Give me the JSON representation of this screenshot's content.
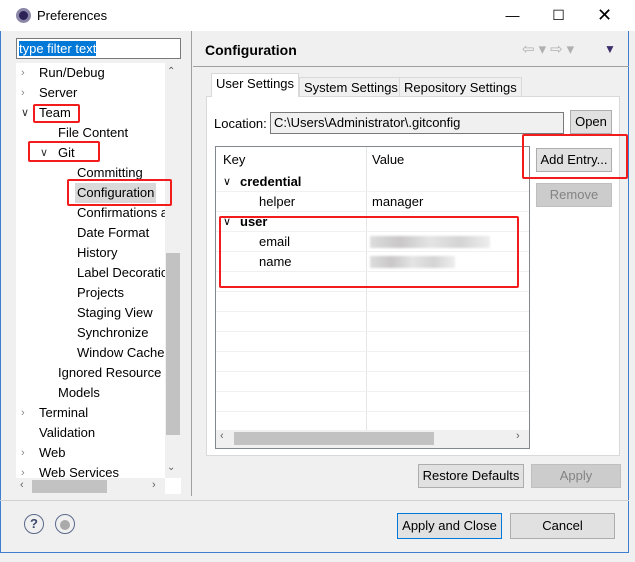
{
  "window": {
    "title": "Preferences",
    "controls": [
      "minimize",
      "maximize",
      "close"
    ]
  },
  "filter": {
    "value": "type filter text"
  },
  "tree": [
    {
      "label": "Run/Debug",
      "level": 0,
      "expander": "collapsed"
    },
    {
      "label": "Server",
      "level": 0,
      "expander": "collapsed"
    },
    {
      "label": "Team",
      "level": 0,
      "expander": "expanded"
    },
    {
      "label": "File Content",
      "level": 1,
      "expander": "none"
    },
    {
      "label": "Git",
      "level": 1,
      "expander": "expanded"
    },
    {
      "label": "Committing",
      "level": 2,
      "expander": "none"
    },
    {
      "label": "Configuration",
      "level": 2,
      "expander": "none",
      "selected": true
    },
    {
      "label": "Confirmations a",
      "level": 2,
      "expander": "none"
    },
    {
      "label": "Date Format",
      "level": 2,
      "expander": "none"
    },
    {
      "label": "History",
      "level": 2,
      "expander": "none"
    },
    {
      "label": "Label Decoratio",
      "level": 2,
      "expander": "none"
    },
    {
      "label": "Projects",
      "level": 2,
      "expander": "none"
    },
    {
      "label": "Staging View",
      "level": 2,
      "expander": "none"
    },
    {
      "label": "Synchronize",
      "level": 2,
      "expander": "none"
    },
    {
      "label": "Window Cache",
      "level": 2,
      "expander": "none"
    },
    {
      "label": "Ignored Resource",
      "level": 1,
      "expander": "none"
    },
    {
      "label": "Models",
      "level": 1,
      "expander": "none"
    },
    {
      "label": "Terminal",
      "level": 0,
      "expander": "collapsed"
    },
    {
      "label": "Validation",
      "level": 0,
      "expander": "none"
    },
    {
      "label": "Web",
      "level": 0,
      "expander": "collapsed"
    },
    {
      "label": "Web Services",
      "level": 0,
      "expander": "collapsed"
    }
  ],
  "page": {
    "title": "Configuration"
  },
  "tabs": [
    {
      "label": "User Settings",
      "active": true
    },
    {
      "label": "System Settings"
    },
    {
      "label": "Repository Settings"
    }
  ],
  "location": {
    "label": "Location:",
    "value": "C:\\Users\\Administrator\\.gitconfig",
    "open_label": "Open"
  },
  "table": {
    "columns": [
      "Key",
      "Value"
    ],
    "rows": [
      {
        "key": "credential",
        "value": "",
        "section": true
      },
      {
        "key": "helper",
        "value": "manager"
      },
      {
        "key": "user",
        "value": "",
        "section": true
      },
      {
        "key": "email",
        "value": "",
        "blurred": true
      },
      {
        "key": "name",
        "value": "",
        "blurred": true
      }
    ]
  },
  "buttons": {
    "add_entry": "Add Entry...",
    "remove": "Remove",
    "restore_defaults": "Restore Defaults",
    "apply": "Apply",
    "apply_close": "Apply and Close",
    "cancel": "Cancel"
  },
  "colors": {
    "annotation": "#f31c1c",
    "selection": "#0078d7"
  }
}
